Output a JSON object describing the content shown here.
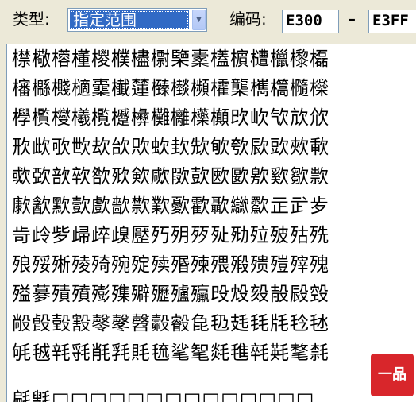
{
  "toolbar": {
    "type_label": "类型:",
    "type_value": "指定范围",
    "code_label": "编码:",
    "range_start": "E300",
    "range_sep": "–",
    "range_end": "E3FF"
  },
  "grid": {
    "rows": [
      "㯲㯳㯴㯵㯶㯷㯸㯹㯺㯻㯼㯽㯾㯿㰀㰁",
      "㰂㰃㰄㰅㰆㰇㰈㰉㰊㰋㰌㰍㰎㰏㰐㰑",
      "㰒㰓㰔㰕㰖㰗㰘㰙㰚㰛㰜㰝㰞㰟㰠㰡",
      "㰢㰣㰤㰥㰦㰧㰨㰩㰪㰫㰬㰭㰮㰯㰰㰱",
      "㰲㰳㰴㰵㰶㰷㰸㰹㰺㰻㰼㰽㰾㰿㱀㱁",
      "㱂㱃㱄㱅㱆㱇㱈㱉㱊㱋㱌㱍㱎㱏㱐㱑",
      "㱒㱓㱔㱕㱖㱗㱘㱙㱚㱛㱜㱝㱞㱟㱠㱡",
      "㱢㱣㱤㱥㱦㱧㱨㱩㱪㱫㱬㱭㱮㱯㱰㱱",
      "㱲㱳㱴㱵㱶㱷㱸㱹㱺㱻㱼㱽㱾㱿㲀㲁",
      "㲂㲃㲄㲅㲆㲇㲈㲉㲊㲋㲌㲍㲎㲏㲐㲑",
      "㲒㲓㲔㲕㲖㲗㲘㲙㲚㲛㲜㲝㲞㲟㲠㲡",
      "㲢㲣□□□□□□□□□□□□□□"
    ]
  },
  "seal": {
    "text": "一品"
  }
}
